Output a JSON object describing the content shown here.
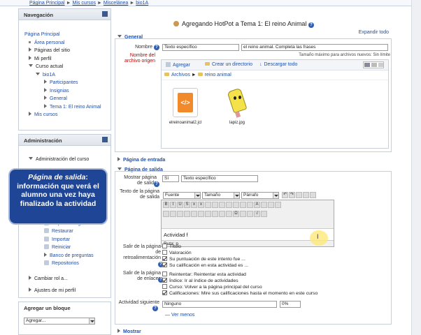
{
  "breadcrumb": [
    "Página Principal",
    "Mis cursos",
    "Miscelánea",
    "bio1A"
  ],
  "nav": {
    "title": "Navegación",
    "items": [
      {
        "label": "Página Principal",
        "level": 0,
        "kind": "link"
      },
      {
        "label": "Área personal",
        "level": 1,
        "kind": "bullet"
      },
      {
        "label": "Páginas del sitio",
        "level": 1,
        "kind": "collapsed"
      },
      {
        "label": "Mi perfil",
        "level": 1,
        "kind": "collapsed"
      },
      {
        "label": "Curso actual",
        "level": 1,
        "kind": "expanded"
      },
      {
        "label": "bio1A",
        "level": 2,
        "kind": "expanded"
      },
      {
        "label": "Participantes",
        "level": 3,
        "kind": "collapsed"
      },
      {
        "label": "Insignias",
        "level": 3,
        "kind": "collapsed"
      },
      {
        "label": "General",
        "level": 3,
        "kind": "collapsed"
      },
      {
        "label": "Tema 1: El reino Animal",
        "level": 3,
        "kind": "collapsed"
      },
      {
        "label": "Mis cursos",
        "level": 1,
        "kind": "collapsed"
      }
    ]
  },
  "admin": {
    "title": "Administración",
    "items": [
      {
        "label": "Administración del curso",
        "kind": "expanded"
      },
      {
        "label": "Copia de seguridad",
        "kind": "icon"
      },
      {
        "label": "Restaurar",
        "kind": "icon"
      },
      {
        "label": "Importar",
        "kind": "icon"
      },
      {
        "label": "Reiniciar",
        "kind": "icon"
      },
      {
        "label": "Banco de preguntas",
        "kind": "collapsed"
      },
      {
        "label": "Repositorios",
        "kind": "icon"
      },
      {
        "label": "Cambiar rol a...",
        "kind": "collapsed"
      },
      {
        "label": "Ajustes de mi perfil",
        "kind": "collapsed"
      }
    ]
  },
  "addblock": {
    "title": "Agregar un bloque",
    "select": "Agregar..."
  },
  "callout": {
    "title": "Página de salida",
    "body": "información que verá el alumno una vez haya finalizado la actividad"
  },
  "page": {
    "title": "Agregando HotPot a Tema 1: El reino Animal",
    "expand_all": "Expandir todo"
  },
  "general": {
    "legend": "General",
    "name_label": "Nombre",
    "name_select": "Texto específico",
    "name_value": "el reino animal. Completa las frases",
    "file_label": "Nombre del archivo origen",
    "max_size": "Tamaño máximo para archivos nuevos: Sin límite",
    "fp_add": "Agregar",
    "fp_create_dir": "Crear un directorio",
    "fp_download": "Descargar todo",
    "path_root": "Archivos",
    "path_sub": "reino animal",
    "files": [
      "elreinoanimal2.jcl",
      "lapiz.jpg"
    ]
  },
  "sections": {
    "entry": "Página de entrada",
    "exit": "Página de salida",
    "show": "Mostrar"
  },
  "exit": {
    "show_label": "Mostrar página de salida",
    "show_value": "Sí",
    "text_select": "Texto específico",
    "text_label": "Texto de la página de salida",
    "font": "Fuente",
    "size": "Tamaño",
    "para": "Párrafo",
    "editor_text": "Actividad f",
    "path": "Ruta: p",
    "feedback_label": "Salir de la página de retroalimentación",
    "feedback": [
      {
        "label": "Título",
        "checked": false
      },
      {
        "label": "Valoración",
        "checked": false
      },
      {
        "label": "Su puntuación de este intento fue ...",
        "checked": true
      },
      {
        "label": "Su calificación en esta actividad es ...",
        "checked": true
      }
    ],
    "links_label": "Salir de la página de enlaces",
    "links": [
      {
        "label": "Reintentar: Reintentar esta actividad",
        "checked": false
      },
      {
        "label": "Índice: Ir al índice de actividades",
        "checked": true
      },
      {
        "label": "Curso: Volver a la página principal del curso",
        "checked": false
      },
      {
        "label": "Calificaciones: Mire sus calificaciones hasta el momento en este curso",
        "checked": true
      }
    ],
    "next_label": "Actividad siguiente",
    "next_value": "Ninguno",
    "next_pct": "0%",
    "see_less": "Ver menos"
  }
}
